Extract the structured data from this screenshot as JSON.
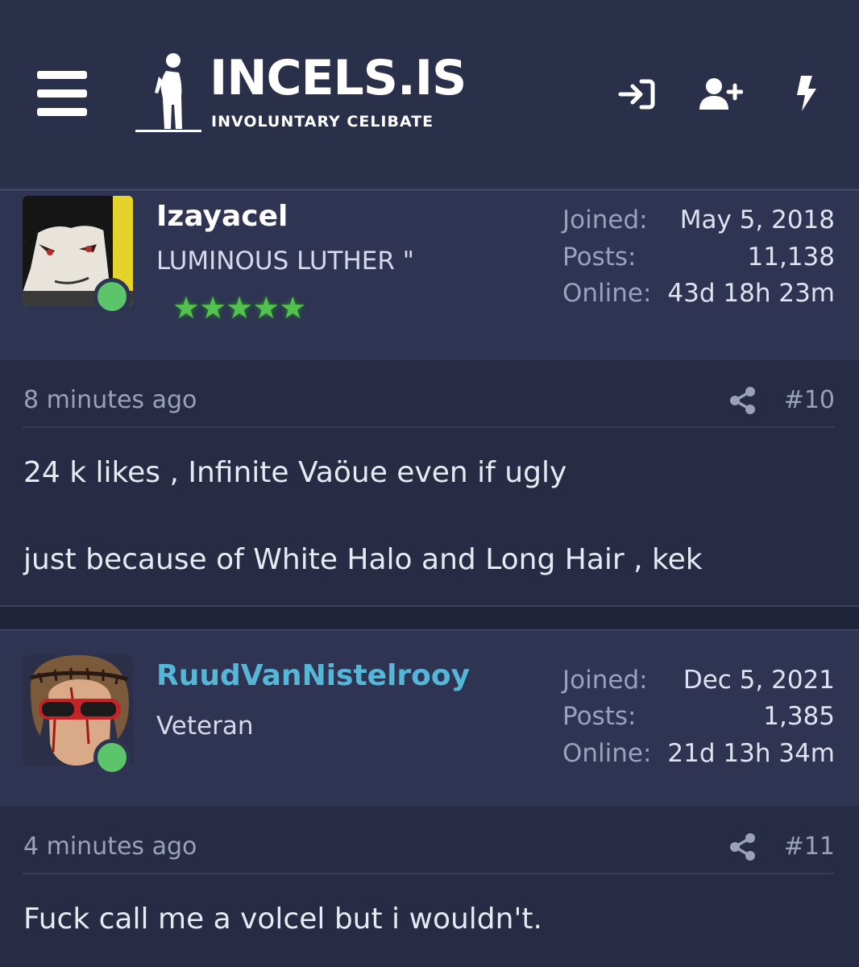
{
  "header": {
    "logo_title": "INCELS.IS",
    "logo_subtitle": "INVOLUNTARY CELIBATE",
    "menu_icon": "hamburger-icon",
    "login_icon": "sign-in-icon",
    "register_icon": "user-plus-icon",
    "whats_new_icon": "bolt-icon"
  },
  "posts": [
    {
      "username": "Izayacel",
      "username_color": "#ffffff",
      "user_title": "LUMINOUS LUTHER \"",
      "stars": "★★★★★",
      "stats": [
        {
          "label": "Joined:",
          "value": "May 5, 2018"
        },
        {
          "label": "Posts:",
          "value": "11,138"
        },
        {
          "label": "Online:",
          "value": "43d 18h 23m"
        }
      ],
      "time": "8 minutes ago",
      "number": "#10",
      "lines": [
        "24 k likes , Infinite Vaöue even if ugly",
        "just because of White Halo and Long Hair , kek"
      ]
    },
    {
      "username": "RuudVanNistelrooy",
      "username_color": "#56b6d8",
      "user_title": "Veteran",
      "stats": [
        {
          "label": "Joined:",
          "value": "Dec 5, 2021"
        },
        {
          "label": "Posts:",
          "value": "1,385"
        },
        {
          "label": "Online:",
          "value": "21d 13h 34m"
        }
      ],
      "time": "4 minutes ago",
      "number": "#11",
      "lines": [
        "Fuck call me a volcel but i wouldn't."
      ]
    }
  ],
  "colors": {
    "background": "#272c44",
    "header": "#2a3049",
    "card": "#2e3452",
    "online": "#5cc46a",
    "star": "#53c14d"
  }
}
